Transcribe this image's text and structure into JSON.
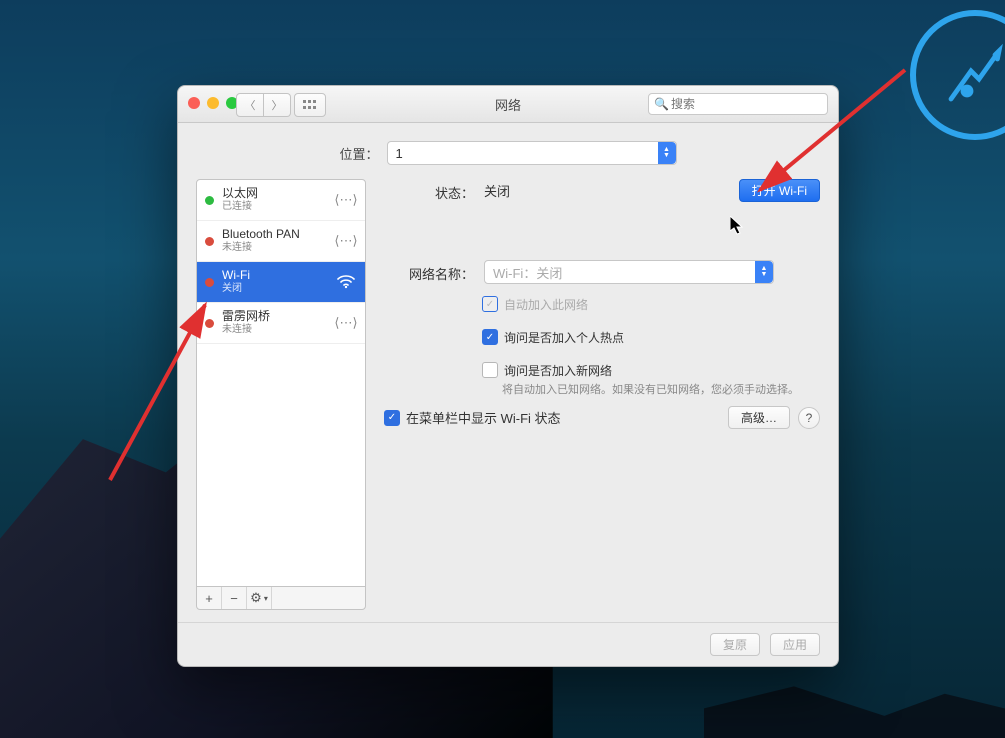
{
  "window": {
    "title": "网络",
    "search_placeholder": "搜索",
    "location": {
      "label": "位置：",
      "value": "1"
    }
  },
  "sidebar": {
    "items": [
      {
        "name": "以太网",
        "sub": "已连接",
        "status": "green",
        "icon": "ethernet"
      },
      {
        "name": "Bluetooth PAN",
        "sub": "未连接",
        "status": "red",
        "icon": "ethernet"
      },
      {
        "name": "Wi-Fi",
        "sub": "关闭",
        "status": "red",
        "icon": "wifi",
        "selected": true
      },
      {
        "name": "雷雳网桥",
        "sub": "未连接",
        "status": "red",
        "icon": "ethernet"
      }
    ],
    "footer": {
      "add": "+",
      "remove": "−",
      "gear": "⚙"
    }
  },
  "detail": {
    "status_label": "状态：",
    "status_value": "关闭",
    "toggle_button": "打开 Wi-Fi",
    "network_name_label": "网络名称：",
    "network_name_value": "Wi-Fi：关闭",
    "checkboxes": {
      "auto_join": {
        "label": "自动加入此网络",
        "checked": true,
        "disabled": true
      },
      "ask_hotspot": {
        "label": "询问是否加入个人热点",
        "checked": true,
        "disabled": false
      },
      "ask_new": {
        "label": "询问是否加入新网络",
        "checked": false,
        "disabled": false
      }
    },
    "ask_new_hint": "将自动加入已知网络。如果没有已知网络，您必须手动选择。",
    "show_menu": {
      "label": "在菜单栏中显示 Wi-Fi 状态",
      "checked": true
    },
    "advanced_button": "高级…",
    "help": "?"
  },
  "footer": {
    "revert": "复原",
    "apply": "应用"
  }
}
